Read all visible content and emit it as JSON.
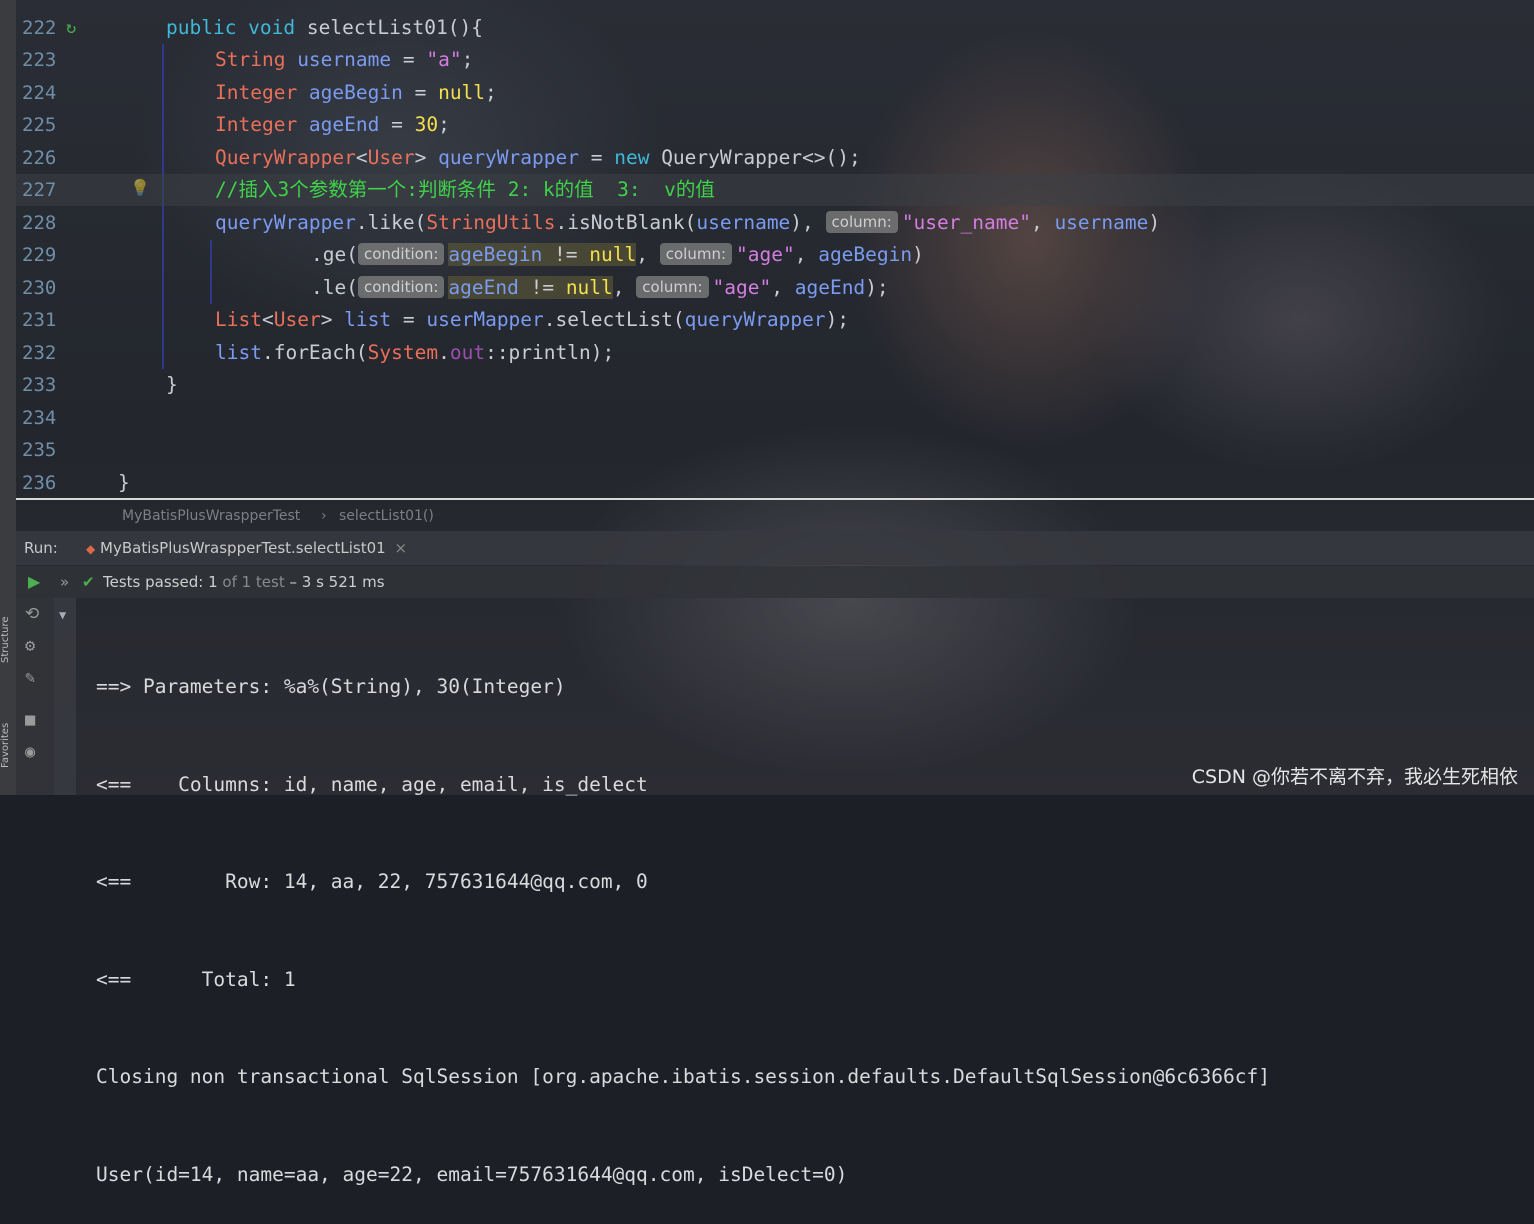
{
  "editor": {
    "lines": [
      {
        "n": "222"
      },
      {
        "n": "223"
      },
      {
        "n": "224"
      },
      {
        "n": "225"
      },
      {
        "n": "226"
      },
      {
        "n": "227"
      },
      {
        "n": "228"
      },
      {
        "n": "229"
      },
      {
        "n": "230"
      },
      {
        "n": "231"
      },
      {
        "n": "232"
      },
      {
        "n": "233"
      },
      {
        "n": "234"
      },
      {
        "n": "235"
      },
      {
        "n": "236"
      }
    ],
    "code": {
      "l222": {
        "kw1": "public void ",
        "rest": "selectList01(){"
      },
      "l223": {
        "type": "String ",
        "var": "username",
        "eq": " = ",
        "str": "\"a\"",
        "end": ";"
      },
      "l224": {
        "type": "Integer ",
        "var": "ageBegin",
        "eq": " = ",
        "val": "null",
        "end": ";"
      },
      "l225": {
        "type": "Integer ",
        "var": "ageEnd",
        "eq": " = ",
        "val": "30",
        "end": ";"
      },
      "l226": {
        "type": "QueryWrapper",
        "lt": "<",
        "type2": "User",
        "gt": "> ",
        "var": "queryWrapper",
        "eq": " = ",
        "kw": "new ",
        "rest": "QueryWrapper<>();"
      },
      "l227": {
        "comment": "//插入3个参数第一个:判断条件 2: k的值  3:  v的值"
      },
      "l228": {
        "var": "queryWrapper",
        "mid": ".like(",
        "type": "StringUtils",
        "mid2": ".isNotBlank(",
        "var2": "username",
        "mid3": "), ",
        "hint": "column:",
        "str": "\"user_name\"",
        "sep": ", ",
        "var3": "username",
        "end": ")"
      },
      "l229": {
        "mid": ".ge(",
        "hint": "condition:",
        "var": "ageBegin",
        "op": " != ",
        "val": "null",
        "sep": ", ",
        "hint2": "column:",
        "str": "\"age\"",
        "sep2": ", ",
        "var2": "ageBegin",
        "end": ")"
      },
      "l230": {
        "mid": ".le(",
        "hint": "condition:",
        "var": "ageEnd",
        "op": " != ",
        "val": "null",
        "sep": ", ",
        "hint2": "column:",
        "str": "\"age\"",
        "sep2": ", ",
        "var2": "ageEnd",
        "end": ");"
      },
      "l231": {
        "type": "List",
        "lt": "<",
        "type2": "User",
        "gt": "> ",
        "var": "list",
        "eq": " = ",
        "var2": "userMapper",
        "mid": ".selectList(",
        "var3": "queryWrapper",
        "end": ");"
      },
      "l232": {
        "var": "list",
        "mid": ".forEach(",
        "type": "System",
        "dot": ".",
        "fld": "out",
        "end": "::println);"
      },
      "l233": {
        "text": "}"
      },
      "l236": {
        "text": "}"
      }
    }
  },
  "breadcrumb": {
    "class_name": "MyBatisPlusWraspperTest",
    "separator": "›",
    "method": "selectList01()"
  },
  "run": {
    "label": "Run:",
    "tab_label": "MyBatisPlusWraspperTest.selectList01",
    "close": "×"
  },
  "tests": {
    "passed_label": "Tests passed:",
    "count": "1",
    "of_text": "of 1 test",
    "time": "– 3 s 521 ms"
  },
  "console": {
    "lines": [
      "==> Parameters: %a%(String), 30(Integer)",
      "<==    Columns: id, name, age, email, is_delect",
      "<==        Row: 14, aa, 22, 757631644@qq.com, 0",
      "<==      Total: 1",
      "Closing non transactional SqlSession [org.apache.ibatis.session.defaults.DefaultSqlSession@6c6366cf]",
      "User(id=14, name=aa, age=22, email=757631644@qq.com, isDelect=0)"
    ]
  },
  "sidebar": {
    "structure": "Structure",
    "favorites": "Favorites"
  },
  "watermark": "CSDN @你若不离不弃，我必生死相依"
}
